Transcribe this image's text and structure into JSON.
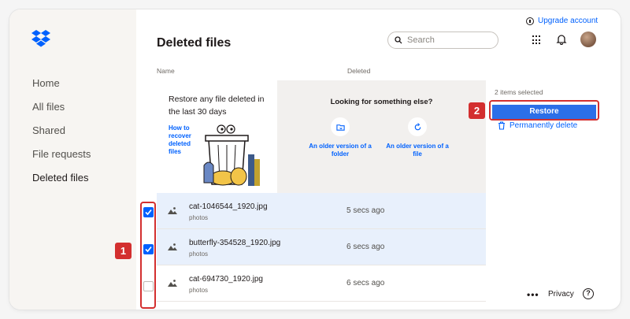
{
  "app": {
    "name": "Dropbox"
  },
  "header": {
    "title": "Deleted files",
    "search_placeholder": "Search",
    "upgrade_label": "Upgrade account"
  },
  "sidebar": {
    "items": [
      {
        "label": "Home"
      },
      {
        "label": "All files"
      },
      {
        "label": "Shared"
      },
      {
        "label": "File requests"
      },
      {
        "label": "Deleted files",
        "active": true
      }
    ]
  },
  "table": {
    "columns": [
      "Name",
      "Deleted"
    ],
    "rows": [
      {
        "name": "cat-1046544_1920.jpg",
        "folder": "photos",
        "deleted": "5 secs ago",
        "selected": true
      },
      {
        "name": "butterfly-354528_1920.jpg",
        "folder": "photos",
        "deleted": "6 secs ago",
        "selected": true
      },
      {
        "name": "cat-694730_1920.jpg",
        "folder": "photos",
        "deleted": "6 secs ago",
        "selected": false
      }
    ]
  },
  "promo": {
    "restore_text": "Restore any file deleted in the last 30 days",
    "how_to_link": "How to recover deleted files",
    "looking_title": "Looking for something else?",
    "option_folder": "An older version of a folder",
    "option_file": "An older version of a file"
  },
  "selection": {
    "count_text": "2 items selected",
    "restore_label": "Restore",
    "perm_delete_label": "Permanently delete"
  },
  "annotations": {
    "badge_1": "1",
    "badge_2": "2"
  },
  "footer": {
    "more": "•••",
    "privacy": "Privacy",
    "help": "?"
  },
  "colors": {
    "accent": "#0061fe",
    "highlight": "#d32f2f",
    "selected_row": "#e8f0fc"
  }
}
